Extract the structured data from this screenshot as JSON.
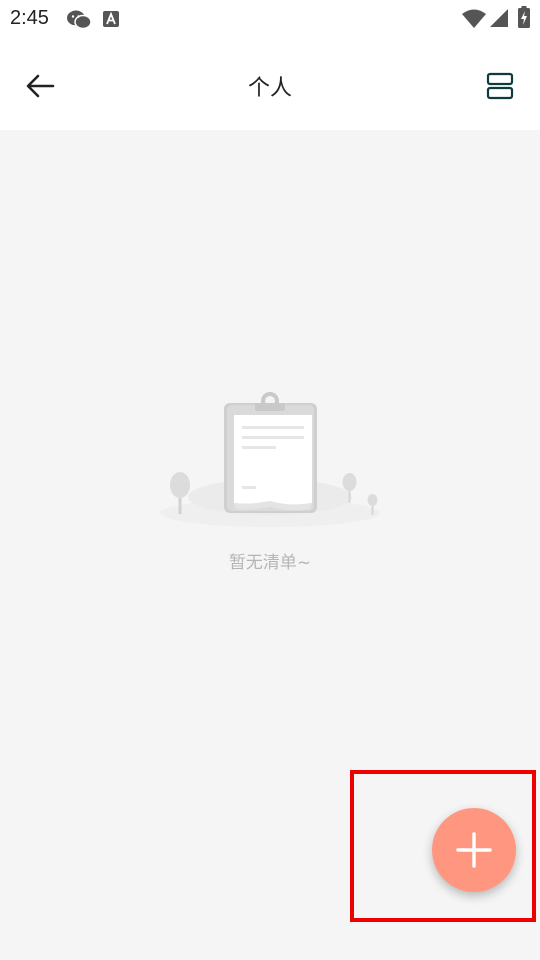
{
  "status_bar": {
    "time": "2:45",
    "icons": [
      "wechat-icon",
      "a-notification-icon",
      "wifi-icon",
      "signal-icon",
      "battery-charging-icon"
    ]
  },
  "app_bar": {
    "title": "个人",
    "back_icon": "arrow-left-icon",
    "layout_icon": "view-split-icon"
  },
  "empty_state": {
    "text": "暂无清单~",
    "illustration": "empty-clipboard-illustration"
  },
  "fab": {
    "icon": "plus-icon",
    "color": "#ff9780"
  },
  "highlight_color": "#ee0000"
}
